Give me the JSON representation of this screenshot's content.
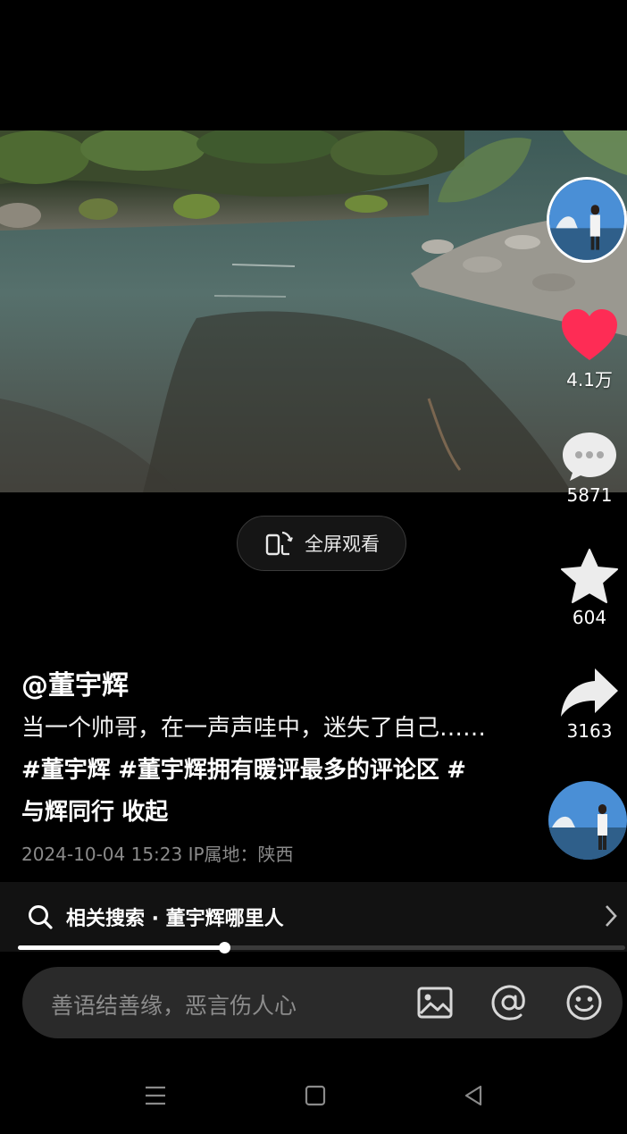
{
  "video": {
    "fullscreen_label": "全屏观看",
    "progress_fraction": 0.34
  },
  "rail": {
    "likes": "4.1万",
    "comments": "5871",
    "favorites": "604",
    "shares": "3163",
    "like_color": "#fe2c55"
  },
  "post": {
    "author": "@董宇辉",
    "text": "当一个帅哥，在一声声哇中，迷失了自己……",
    "tags": [
      "#董宇辉",
      "#董宇辉拥有暖评最多的评论区",
      "#与辉同行"
    ],
    "collapse_label": "收起",
    "datetime": "2024-10-04 15:23",
    "ip_label": "IP属地：陕西"
  },
  "related_search": {
    "label": "相关搜索 · 董宇辉哪里人"
  },
  "comment_input": {
    "placeholder": "善语结善缘，恶言伤人心"
  }
}
